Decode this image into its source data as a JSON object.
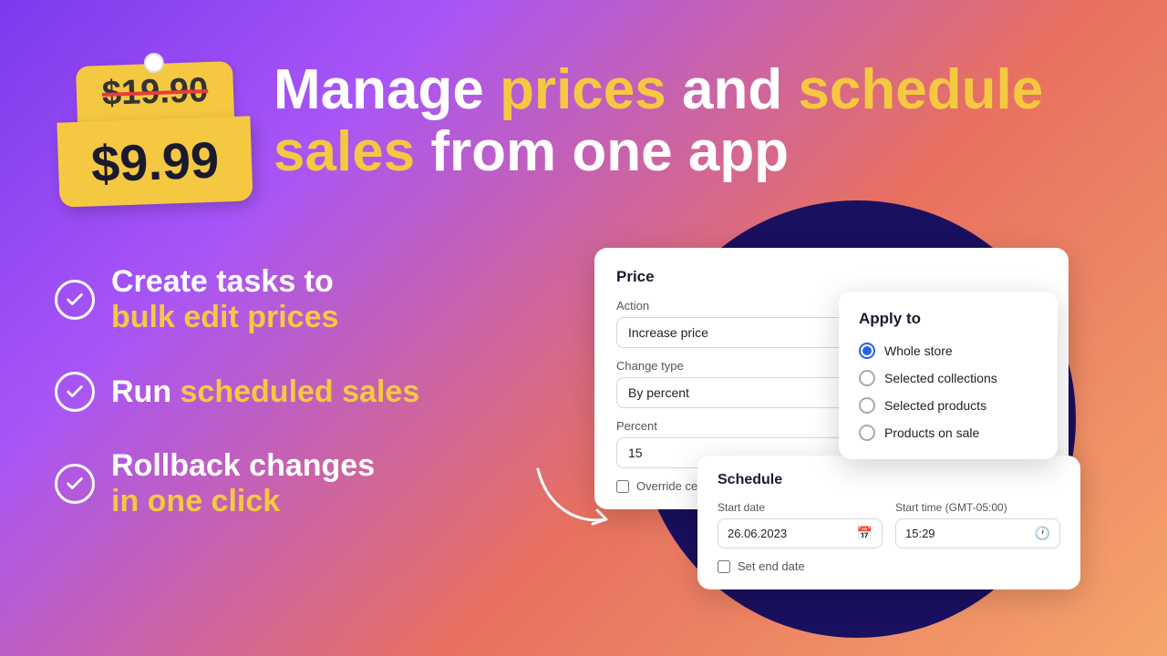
{
  "background": {
    "gradient_start": "#7c3aed",
    "gradient_end": "#f4a56a"
  },
  "price_tags": {
    "old_price": "$19.90",
    "new_price": "$9.99"
  },
  "headline": {
    "line1_white": "Manage ",
    "line1_gold": "prices",
    "line1_white2": " and ",
    "line1_gold2": "schedule",
    "line2_gold": "sales",
    "line2_white": " from one app"
  },
  "features": [
    {
      "white": "Create tasks to",
      "gold": "bulk edit prices"
    },
    {
      "white": "Run ",
      "gold": "scheduled sales"
    },
    {
      "white": "Rollback changes",
      "gold": "in one click"
    }
  ],
  "price_card": {
    "title": "Price",
    "action_label": "Action",
    "action_value": "Increase price",
    "change_type_label": "Change type",
    "change_type_value": "By percent",
    "percent_label": "Percent",
    "percent_value": "15",
    "override_cents_label": "Override cents"
  },
  "apply_card": {
    "title": "Apply to",
    "options": [
      {
        "label": "Whole store",
        "selected": true
      },
      {
        "label": "Selected collections",
        "selected": false
      },
      {
        "label": "Selected products",
        "selected": false
      },
      {
        "label": "Products on sale",
        "selected": false
      }
    ]
  },
  "schedule_card": {
    "title": "Schedule",
    "start_date_label": "Start date",
    "start_date_value": "26.06.2023",
    "start_time_label": "Start time (GMT-05:00)",
    "start_time_value": "15:29",
    "set_end_date_label": "Set end date"
  }
}
